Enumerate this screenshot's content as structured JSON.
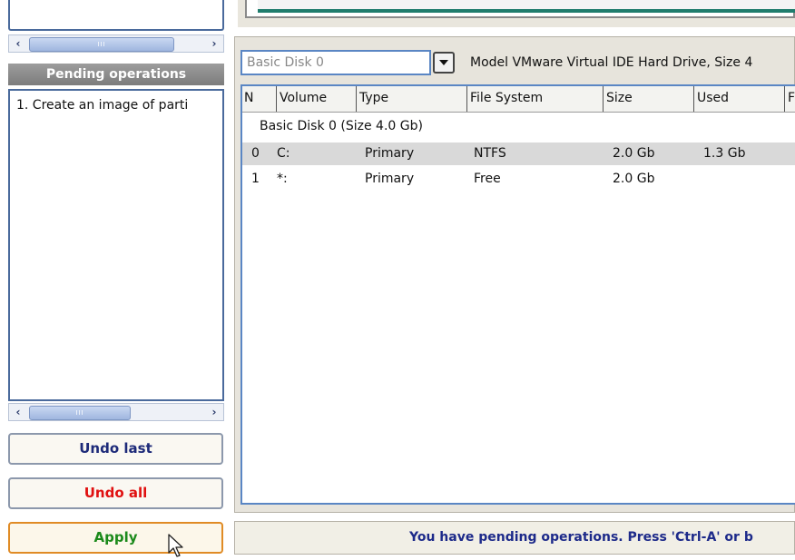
{
  "sidebar": {
    "pending_title": "Pending operations",
    "pending_items": [
      "1. Create an image of parti"
    ],
    "undo_last_label": "Undo last",
    "undo_all_label": "Undo all",
    "apply_label": "Apply"
  },
  "disk_selector": {
    "value": "Basic Disk 0",
    "model_text": "Model VMware Virtual IDE Hard Drive, Size 4"
  },
  "table": {
    "columns": [
      "N",
      "Volume",
      "Type",
      "File System",
      "Size",
      "Used",
      "F"
    ],
    "group_label": "Basic Disk 0 (Size 4.0 Gb)",
    "rows": [
      {
        "n": "0",
        "volume": "C:",
        "type": "Primary",
        "fs": "NTFS",
        "size": "2.0 Gb",
        "used": "1.3 Gb"
      },
      {
        "n": "1",
        "volume": "*:",
        "type": "Primary",
        "fs": "Free",
        "size": "2.0 Gb",
        "used": ""
      }
    ]
  },
  "status": {
    "message": "You have pending operations. Press 'Ctrl-A' or b"
  },
  "colors": {
    "undo_last": "#1d2a79",
    "undo_all": "#e01010",
    "apply": "#1b8a1b",
    "accent_blue": "#5a86c4",
    "teal": "#1f7c6d"
  },
  "icons": {
    "scroll_left": "chevron-left-icon",
    "scroll_right": "chevron-right-icon",
    "dropdown": "triangle-down-icon",
    "cursor": "mouse-pointer-icon"
  }
}
